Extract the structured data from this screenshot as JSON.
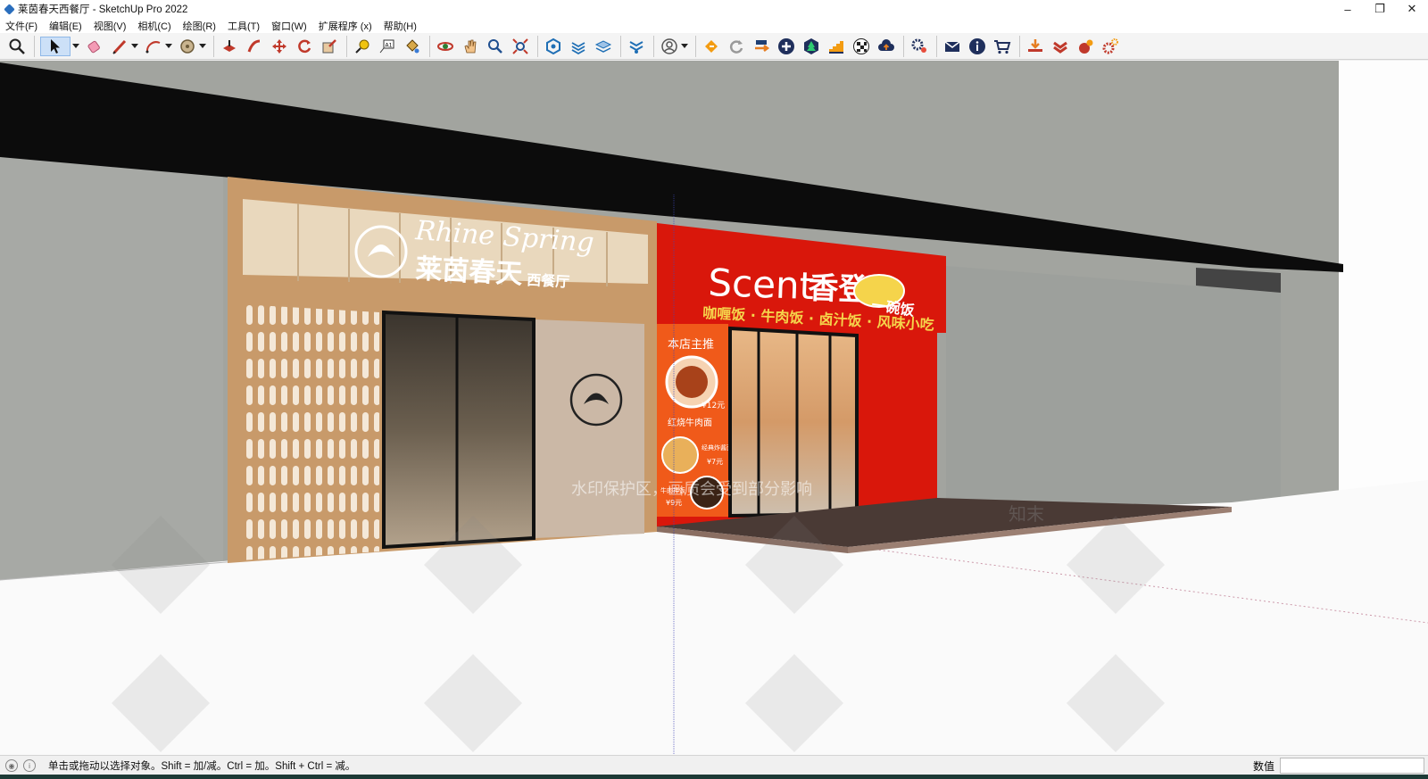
{
  "window": {
    "title": "莱茵春天西餐厅 - SketchUp Pro 2022",
    "controls": {
      "minimize": "–",
      "maximize": "❐",
      "close": "✕"
    }
  },
  "menu": {
    "items": [
      {
        "label": "文件(F)"
      },
      {
        "label": "编辑(E)"
      },
      {
        "label": "视图(V)"
      },
      {
        "label": "相机(C)"
      },
      {
        "label": "绘图(R)"
      },
      {
        "label": "工具(T)"
      },
      {
        "label": "窗口(W)"
      },
      {
        "label": "扩展程序 (x)"
      },
      {
        "label": "帮助(H)"
      }
    ]
  },
  "scene": {
    "left_store": {
      "script_sign": "Rhine Spring",
      "name": "莱茵春天",
      "subtitle": "西餐厅"
    },
    "right_store": {
      "brand_latin": "Scent",
      "brand_cn": "香登",
      "badge": "一碗饭",
      "menu_line": "咖喱饭 · 牛肉饭 · 卤汁饭 · 风味小吃",
      "poster_title": "本店主推",
      "poster_item1": "红烧牛肉面",
      "poster_price1": "¥12元",
      "poster_item2": "经典炸酱面",
      "poster_price2": "¥7元",
      "poster_item3": "牛肉拌饭",
      "poster_price3": "¥9元"
    },
    "watermark_band": "水印保护区，画质会受到部分影响",
    "watermark_logo": "知末"
  },
  "status": {
    "hint": "单击或拖动以选择对象。Shift = 加/减。Ctrl = 加。Shift + Ctrl = 减。",
    "measure_label": "数值"
  },
  "colors": {
    "accent_red": "#d9170b",
    "wood": "#c89a6a",
    "selection_blue": "#cce0f7"
  }
}
